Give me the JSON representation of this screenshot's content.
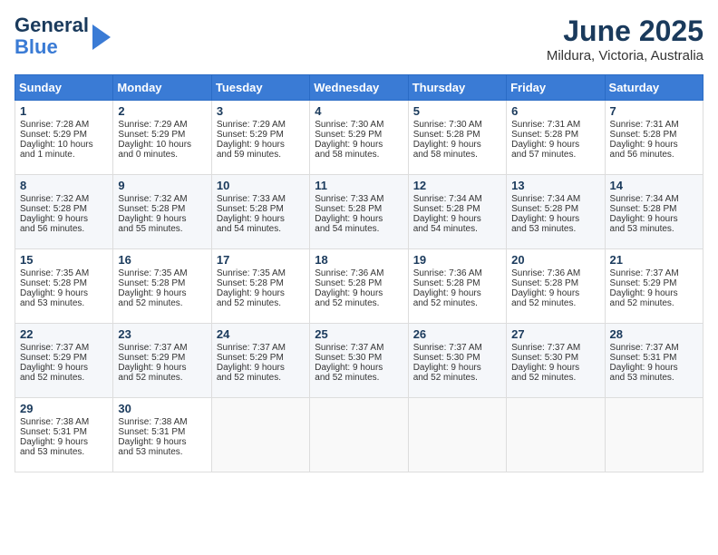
{
  "header": {
    "logo_line1": "General",
    "logo_line2": "Blue",
    "month": "June 2025",
    "location": "Mildura, Victoria, Australia"
  },
  "weekdays": [
    "Sunday",
    "Monday",
    "Tuesday",
    "Wednesday",
    "Thursday",
    "Friday",
    "Saturday"
  ],
  "weeks": [
    [
      {
        "day": 1,
        "info": "Sunrise: 7:28 AM\nSunset: 5:29 PM\nDaylight: 10 hours\nand 1 minute."
      },
      {
        "day": 2,
        "info": "Sunrise: 7:29 AM\nSunset: 5:29 PM\nDaylight: 10 hours\nand 0 minutes."
      },
      {
        "day": 3,
        "info": "Sunrise: 7:29 AM\nSunset: 5:29 PM\nDaylight: 9 hours\nand 59 minutes."
      },
      {
        "day": 4,
        "info": "Sunrise: 7:30 AM\nSunset: 5:29 PM\nDaylight: 9 hours\nand 58 minutes."
      },
      {
        "day": 5,
        "info": "Sunrise: 7:30 AM\nSunset: 5:28 PM\nDaylight: 9 hours\nand 58 minutes."
      },
      {
        "day": 6,
        "info": "Sunrise: 7:31 AM\nSunset: 5:28 PM\nDaylight: 9 hours\nand 57 minutes."
      },
      {
        "day": 7,
        "info": "Sunrise: 7:31 AM\nSunset: 5:28 PM\nDaylight: 9 hours\nand 56 minutes."
      }
    ],
    [
      {
        "day": 8,
        "info": "Sunrise: 7:32 AM\nSunset: 5:28 PM\nDaylight: 9 hours\nand 56 minutes."
      },
      {
        "day": 9,
        "info": "Sunrise: 7:32 AM\nSunset: 5:28 PM\nDaylight: 9 hours\nand 55 minutes."
      },
      {
        "day": 10,
        "info": "Sunrise: 7:33 AM\nSunset: 5:28 PM\nDaylight: 9 hours\nand 54 minutes."
      },
      {
        "day": 11,
        "info": "Sunrise: 7:33 AM\nSunset: 5:28 PM\nDaylight: 9 hours\nand 54 minutes."
      },
      {
        "day": 12,
        "info": "Sunrise: 7:34 AM\nSunset: 5:28 PM\nDaylight: 9 hours\nand 54 minutes."
      },
      {
        "day": 13,
        "info": "Sunrise: 7:34 AM\nSunset: 5:28 PM\nDaylight: 9 hours\nand 53 minutes."
      },
      {
        "day": 14,
        "info": "Sunrise: 7:34 AM\nSunset: 5:28 PM\nDaylight: 9 hours\nand 53 minutes."
      }
    ],
    [
      {
        "day": 15,
        "info": "Sunrise: 7:35 AM\nSunset: 5:28 PM\nDaylight: 9 hours\nand 53 minutes."
      },
      {
        "day": 16,
        "info": "Sunrise: 7:35 AM\nSunset: 5:28 PM\nDaylight: 9 hours\nand 52 minutes."
      },
      {
        "day": 17,
        "info": "Sunrise: 7:35 AM\nSunset: 5:28 PM\nDaylight: 9 hours\nand 52 minutes."
      },
      {
        "day": 18,
        "info": "Sunrise: 7:36 AM\nSunset: 5:28 PM\nDaylight: 9 hours\nand 52 minutes."
      },
      {
        "day": 19,
        "info": "Sunrise: 7:36 AM\nSunset: 5:28 PM\nDaylight: 9 hours\nand 52 minutes."
      },
      {
        "day": 20,
        "info": "Sunrise: 7:36 AM\nSunset: 5:28 PM\nDaylight: 9 hours\nand 52 minutes."
      },
      {
        "day": 21,
        "info": "Sunrise: 7:37 AM\nSunset: 5:29 PM\nDaylight: 9 hours\nand 52 minutes."
      }
    ],
    [
      {
        "day": 22,
        "info": "Sunrise: 7:37 AM\nSunset: 5:29 PM\nDaylight: 9 hours\nand 52 minutes."
      },
      {
        "day": 23,
        "info": "Sunrise: 7:37 AM\nSunset: 5:29 PM\nDaylight: 9 hours\nand 52 minutes."
      },
      {
        "day": 24,
        "info": "Sunrise: 7:37 AM\nSunset: 5:29 PM\nDaylight: 9 hours\nand 52 minutes."
      },
      {
        "day": 25,
        "info": "Sunrise: 7:37 AM\nSunset: 5:30 PM\nDaylight: 9 hours\nand 52 minutes."
      },
      {
        "day": 26,
        "info": "Sunrise: 7:37 AM\nSunset: 5:30 PM\nDaylight: 9 hours\nand 52 minutes."
      },
      {
        "day": 27,
        "info": "Sunrise: 7:37 AM\nSunset: 5:30 PM\nDaylight: 9 hours\nand 52 minutes."
      },
      {
        "day": 28,
        "info": "Sunrise: 7:37 AM\nSunset: 5:31 PM\nDaylight: 9 hours\nand 53 minutes."
      }
    ],
    [
      {
        "day": 29,
        "info": "Sunrise: 7:38 AM\nSunset: 5:31 PM\nDaylight: 9 hours\nand 53 minutes."
      },
      {
        "day": 30,
        "info": "Sunrise: 7:38 AM\nSunset: 5:31 PM\nDaylight: 9 hours\nand 53 minutes."
      },
      null,
      null,
      null,
      null,
      null
    ]
  ]
}
